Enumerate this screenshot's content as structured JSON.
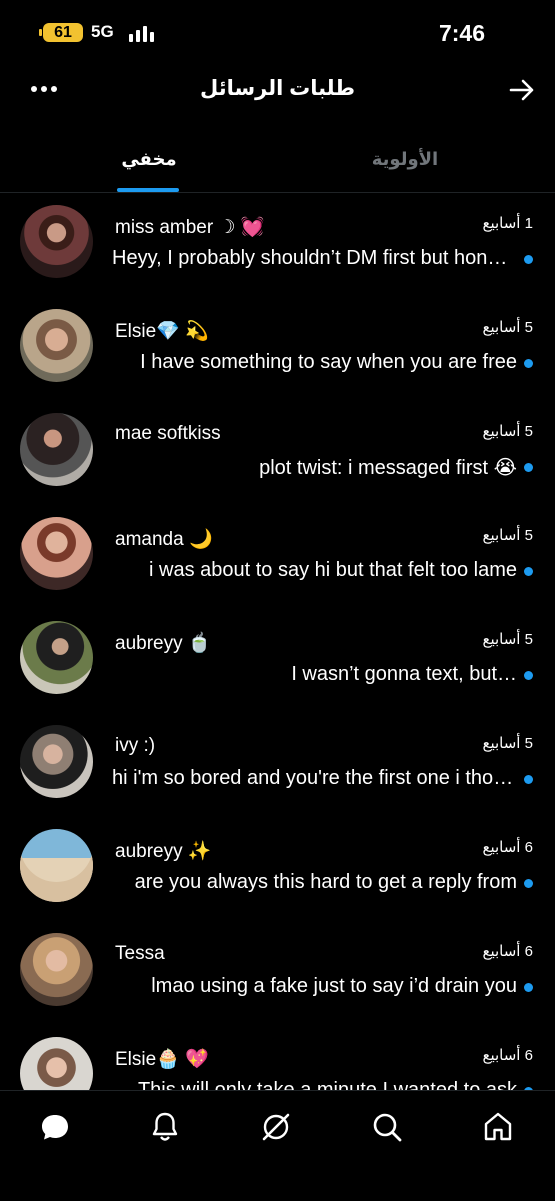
{
  "status": {
    "battery": "61",
    "network": "5G",
    "time": "7:46"
  },
  "header": {
    "title": "طلبات الرسائل",
    "more_icon": "more-dots-icon",
    "back_icon": "arrow-right-icon"
  },
  "tabs": [
    {
      "label": "مخفي",
      "active": true
    },
    {
      "label": "الأولوية",
      "active": false
    }
  ],
  "messages": [
    {
      "name": "miss amber ☽ 💓",
      "time": "1 أسابيع",
      "preview": "Heyy, I probably shouldn’t DM first but honestly",
      "unread": true
    },
    {
      "name": "Elsie💎 💫",
      "time": "5 أسابيع",
      "preview": "I have something to say when you are free",
      "unread": true
    },
    {
      "name": "mae softkiss",
      "time": "5 أسابيع",
      "preview": "plot twist: i messaged first 😭",
      "unread": true
    },
    {
      "name": "amanda 🌙",
      "time": "5 أسابيع",
      "preview": "i was about to say hi but that felt too lame",
      "unread": true
    },
    {
      "name": "aubreyy 🍵",
      "time": "5 أسابيع",
      "preview": "I wasn’t gonna text, but…",
      "unread": true
    },
    {
      "name": "ivy :)",
      "time": "5 أسابيع",
      "preview": "hi i'm so bored and you're the first one i thought of",
      "unread": true
    },
    {
      "name": "aubreyy ✨",
      "time": "6 أسابيع",
      "preview": "are you always this hard to get a reply from",
      "unread": true
    },
    {
      "name": "Tessa",
      "time": "6 أسابيع",
      "preview": "lmao using a fake just to say i’d drain you",
      "unread": true
    },
    {
      "name": "Elsie🧁 💖",
      "time": "6 أسابيع",
      "preview": "This will only take a minute I wanted to ask",
      "unread": true
    }
  ],
  "bottom_nav": [
    "home-icon",
    "search-icon",
    "grok-icon",
    "notifications-bell-icon",
    "messages-icon"
  ],
  "colors": {
    "background": "#000000",
    "accent": "#1d9bf0",
    "muted": "#71767b"
  }
}
